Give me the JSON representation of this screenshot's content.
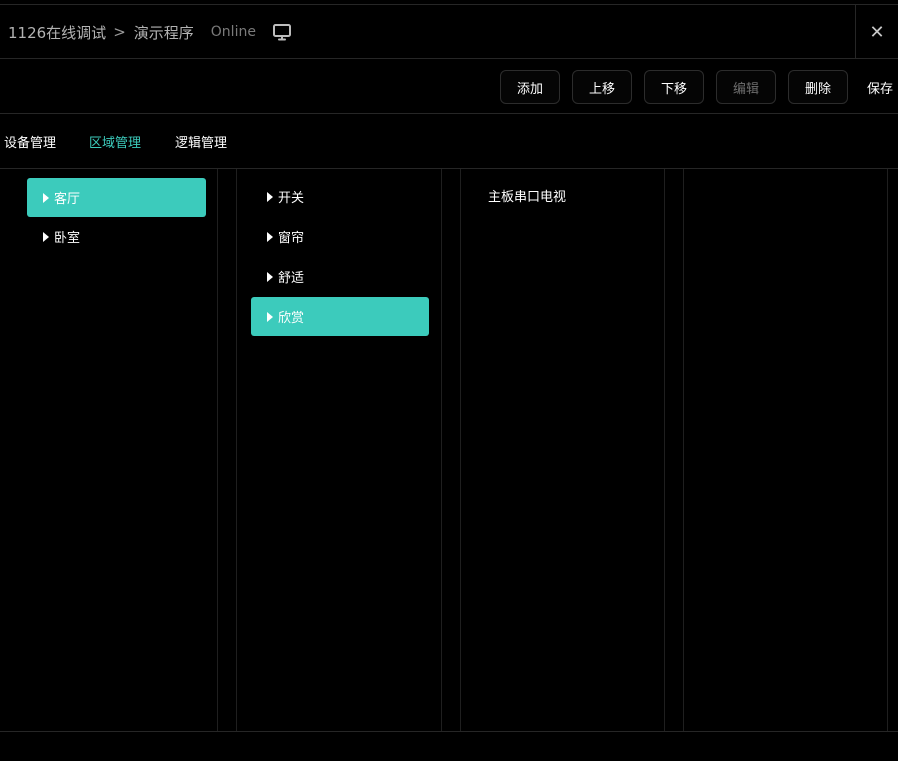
{
  "header": {
    "breadcrumb_root": "1126在线调试",
    "breadcrumb_separator": ">",
    "breadcrumb_current": "演示程序",
    "status": "Online",
    "monitor_icon": "monitor-icon",
    "close_label": "✕"
  },
  "toolbar": {
    "add_label": "添加",
    "move_up_label": "上移",
    "move_down_label": "下移",
    "edit_label": "编辑",
    "delete_label": "删除",
    "save_label": "保存"
  },
  "tabs": [
    {
      "label": "设备管理",
      "active": false
    },
    {
      "label": "区域管理",
      "active": true
    },
    {
      "label": "逻辑管理",
      "active": false
    }
  ],
  "rooms": [
    {
      "label": "客厅",
      "selected": true
    },
    {
      "label": "卧室",
      "selected": false
    }
  ],
  "scenes": [
    {
      "label": "开关",
      "selected": false
    },
    {
      "label": "窗帘",
      "selected": false
    },
    {
      "label": "舒适",
      "selected": false
    },
    {
      "label": "欣赏",
      "selected": true
    }
  ],
  "devices": [
    {
      "label": "主板串口电视"
    }
  ],
  "colors": {
    "accent": "#3ccbbc",
    "background": "#000000",
    "border": "#262626"
  }
}
